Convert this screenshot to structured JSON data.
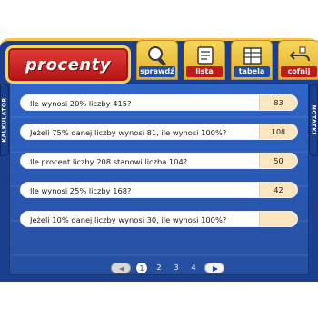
{
  "app": {
    "title": "procenty"
  },
  "toolbar": {
    "buttons": [
      {
        "name": "sprawdz",
        "label": "sprawdź",
        "icon": "magnifier-icon"
      },
      {
        "name": "lista",
        "label": "lista",
        "icon": "list-icon"
      },
      {
        "name": "tabela",
        "label": "tabela",
        "icon": "table-icon"
      },
      {
        "name": "cofnij",
        "label": "cofnij",
        "icon": "undo-icon"
      }
    ]
  },
  "side_tabs": {
    "left_label": "KALKULATOR",
    "right_label": "NOTATKI"
  },
  "questions": [
    {
      "text": "Ile wynosi 20% liczby 415?",
      "answer": "83"
    },
    {
      "text": "Jeżeli 75% danej liczby wynosi 81, ile wynosi 100%?",
      "answer": "108"
    },
    {
      "text": "Ile procent liczby 208 stanowi liczba 104?",
      "answer": "50"
    },
    {
      "text": "Ile wynosi 25% liczby 168?",
      "answer": "42"
    },
    {
      "text": "Jeżeli 10% danej liczby wynosi 30, ile wynosi 100%?",
      "answer": ""
    }
  ],
  "pager": {
    "pages": [
      "1",
      "2",
      "3",
      "4"
    ],
    "current": "1"
  },
  "colors": {
    "frame_blue": "#1b3f8f",
    "accent_yellow": "#f2c84b",
    "title_red": "#c11a1a",
    "answer_bg": "#fbe6bf"
  }
}
